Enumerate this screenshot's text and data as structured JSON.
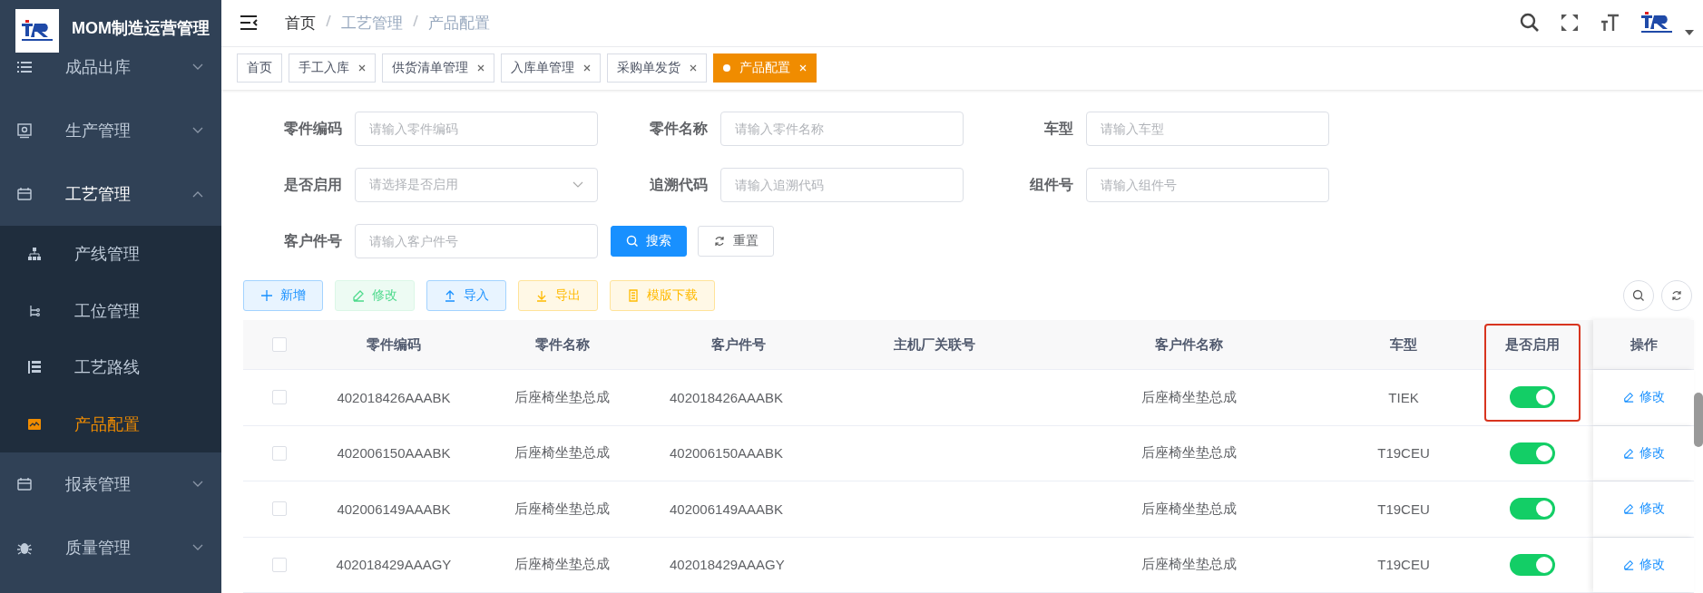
{
  "sidebar": {
    "title": "MOM制造运营管理",
    "items": [
      {
        "label": "成品出库",
        "expanded": false
      },
      {
        "label": "生产管理",
        "expanded": false
      },
      {
        "label": "工艺管理",
        "expanded": true,
        "children": [
          {
            "label": "产线管理",
            "selected": false
          },
          {
            "label": "工位管理",
            "selected": false
          },
          {
            "label": "工艺路线",
            "selected": false
          },
          {
            "label": "产品配置",
            "selected": true
          }
        ]
      },
      {
        "label": "报表管理",
        "expanded": false
      },
      {
        "label": "质量管理",
        "expanded": false
      }
    ]
  },
  "breadcrumb": [
    "首页",
    "工艺管理",
    "产品配置"
  ],
  "tabs": [
    {
      "label": "首页",
      "selected": false,
      "closable": false
    },
    {
      "label": "手工入库",
      "selected": false,
      "closable": true
    },
    {
      "label": "供货清单管理",
      "selected": false,
      "closable": true
    },
    {
      "label": "入库单管理",
      "selected": false,
      "closable": true
    },
    {
      "label": "采购单发货",
      "selected": false,
      "closable": true
    },
    {
      "label": "产品配置",
      "selected": true,
      "closable": true
    }
  ],
  "filters": [
    {
      "label": "零件编码",
      "placeholder": "请输入零件编码",
      "kind": "input"
    },
    {
      "label": "零件名称",
      "placeholder": "请输入零件名称",
      "kind": "input"
    },
    {
      "label": "车型",
      "placeholder": "请输入车型",
      "kind": "input"
    },
    {
      "label": "是否启用",
      "placeholder": "请选择是否启用",
      "kind": "select"
    },
    {
      "label": "追溯代码",
      "placeholder": "请输入追溯代码",
      "kind": "input"
    },
    {
      "label": "组件号",
      "placeholder": "请输入组件号",
      "kind": "input"
    },
    {
      "label": "客户件号",
      "placeholder": "请输入客户件号",
      "kind": "input"
    }
  ],
  "search_button": "搜索",
  "reset_button": "重置",
  "toolbar": [
    {
      "label": "新增",
      "kind": "add"
    },
    {
      "label": "修改",
      "kind": "edit"
    },
    {
      "label": "导入",
      "kind": "import"
    },
    {
      "label": "导出",
      "kind": "export"
    },
    {
      "label": "模版下载",
      "kind": "template"
    }
  ],
  "table": {
    "all_checked": false,
    "columns": [
      {
        "label": "零件编码",
        "highlighted": false
      },
      {
        "label": "零件名称",
        "highlighted": false
      },
      {
        "label": "客户件号",
        "highlighted": false
      },
      {
        "label": "主机厂关联号",
        "highlighted": false
      },
      {
        "label": "客户件名称",
        "highlighted": false
      },
      {
        "label": "车型",
        "highlighted": false
      },
      {
        "label": "是否启用",
        "highlighted": true
      },
      {
        "label": "操作",
        "highlighted": false
      }
    ],
    "rows": [
      {
        "checked": false,
        "cells": [
          "402018426AAABK",
          "后座椅坐垫总成",
          "402018426AAABK",
          "",
          "后座椅坐垫总成",
          "TIEK"
        ],
        "enabled": true,
        "action": "修改"
      },
      {
        "checked": false,
        "cells": [
          "402006150AAABK",
          "后座椅坐垫总成",
          "402006150AAABK",
          "",
          "后座椅坐垫总成",
          "T19CEU"
        ],
        "enabled": true,
        "action": "修改"
      },
      {
        "checked": false,
        "cells": [
          "402006149AAABK",
          "后座椅坐垫总成",
          "402006149AAABK",
          "",
          "后座椅坐垫总成",
          "T19CEU"
        ],
        "enabled": true,
        "action": "修改"
      },
      {
        "checked": false,
        "cells": [
          "402018429AAAGY",
          "后座椅坐垫总成",
          "402018429AAAGY",
          "",
          "后座椅坐垫总成",
          "T19CEU"
        ],
        "enabled": true,
        "action": "修改"
      }
    ]
  }
}
